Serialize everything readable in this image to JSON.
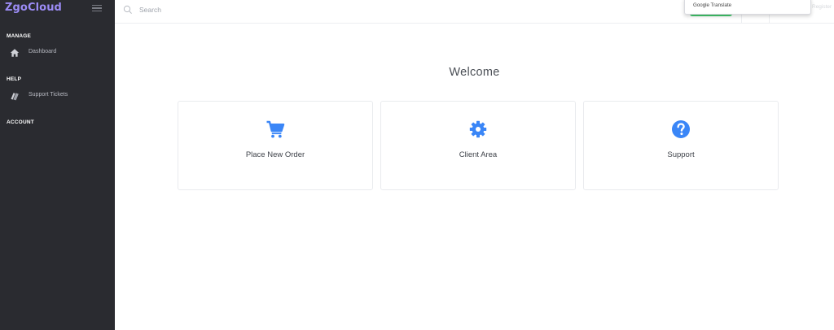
{
  "app": {
    "brand": "ZgoCloud"
  },
  "colors": {
    "brand": "#9c8cf5",
    "sidebar_bg": "#2a2b30",
    "accent_blue": "#3a86f7",
    "accent_green": "#41c96b"
  },
  "sidebar": {
    "sections": [
      {
        "title": "MANAGE",
        "items": [
          {
            "label": "Dashboard",
            "icon": "home-icon"
          }
        ]
      },
      {
        "title": "HELP",
        "items": [
          {
            "label": "Support Tickets",
            "icon": "tickets-icon"
          }
        ]
      },
      {
        "title": "ACCOUNT",
        "items": []
      }
    ]
  },
  "topbar": {
    "search_placeholder": "Search",
    "register_label": "Register",
    "translate_popup": "Google Translate"
  },
  "main": {
    "welcome": "Welcome",
    "cards": [
      {
        "label": "Place New Order",
        "icon": "cart-icon"
      },
      {
        "label": "Client Area",
        "icon": "gear-icon"
      },
      {
        "label": "Support",
        "icon": "question-icon"
      }
    ]
  }
}
